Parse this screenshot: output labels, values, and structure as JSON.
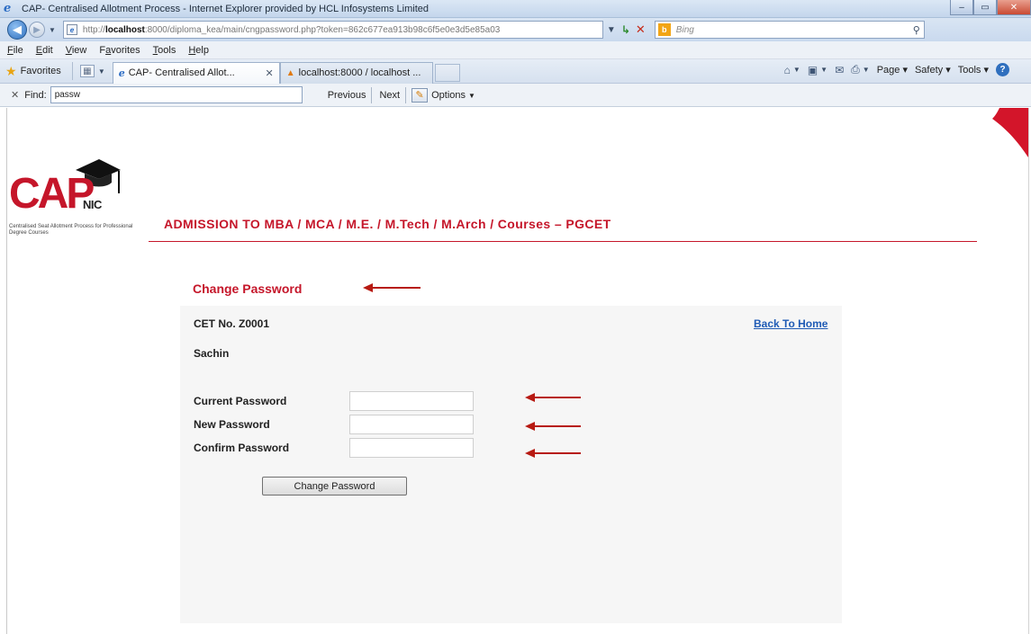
{
  "window": {
    "title": "CAP- Centralised Allotment Process - Internet Explorer provided by HCL Infosystems Limited",
    "controls": {
      "minimize": "–",
      "maximize": "▭",
      "close": "✕"
    }
  },
  "address_bar": {
    "url_prefix": "http://",
    "url_host": "localhost",
    "url_rest": ":8000/diploma_kea/main/cngpassword.php?token=862c677ea913b98c6f5e0e3d5e85a03",
    "search_placeholder": "Bing"
  },
  "menu": {
    "items": [
      {
        "acc": "F",
        "rest": "ile"
      },
      {
        "acc": "E",
        "rest": "dit"
      },
      {
        "acc": "V",
        "rest": "iew"
      },
      {
        "pre": "F",
        "acc": "a",
        "rest": "vorites"
      },
      {
        "acc": "T",
        "rest": "ools"
      },
      {
        "acc": "H",
        "rest": "elp"
      }
    ]
  },
  "favorites_bar": {
    "favorites_label": "Favorites",
    "tabs": [
      {
        "label": "CAP- Centralised Allot...",
        "active": true
      },
      {
        "label": "localhost:8000 / localhost ...",
        "active": false
      }
    ],
    "commands": {
      "page": "Page",
      "safety": "Safety",
      "tools": "Tools"
    }
  },
  "find_bar": {
    "label": "Find:",
    "value": "passw",
    "previous": "Previous",
    "next": "Next",
    "options": "Options"
  },
  "page": {
    "logo": {
      "cap": "CAP",
      "nic": "NIC",
      "subtitle": "Centralised Seat Allotment Process for Professional Degree Courses"
    },
    "heading": "ADMISSION TO MBA / MCA / M.E. / M.Tech / M.Arch / Courses – PGCET",
    "change_title": "Change Password",
    "cet_no": "CET No. Z0001",
    "back_home": "Back To Home",
    "user_name": "Sachin",
    "fields": [
      {
        "label": "Current Password",
        "value": ""
      },
      {
        "label": "New Password",
        "value": ""
      },
      {
        "label": "Confirm Password",
        "value": ""
      }
    ],
    "submit_label": "Change Password"
  },
  "colors": {
    "brand_red": "#c5162a",
    "link_blue": "#1f5bb5",
    "arrow_red": "#b71a12"
  }
}
